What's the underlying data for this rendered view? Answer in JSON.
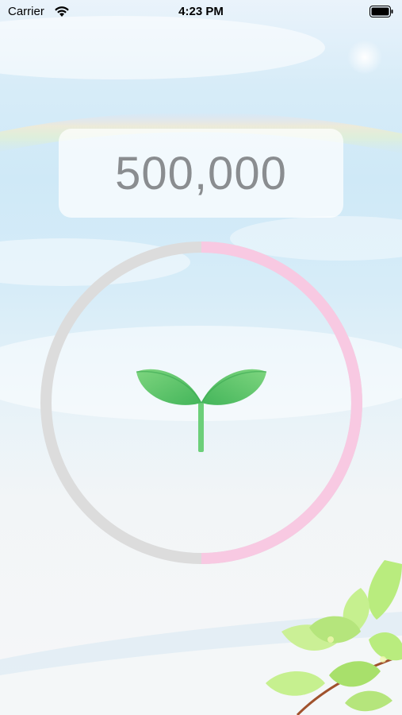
{
  "status_bar": {
    "carrier": "Carrier",
    "time": "4:23 PM",
    "icons": [
      "wifi-icon",
      "battery-icon"
    ]
  },
  "counter": {
    "value": "500,000"
  },
  "progress_ring": {
    "progress": 0.5,
    "track_color": "#dcdcdc",
    "fill_color": "#f8c9e2"
  },
  "sprout": {
    "icon": "sprout-icon",
    "leaf_color": "#5cc96a",
    "stem_color": "#6ccf79"
  },
  "decor": {
    "icon": "leaves-icon"
  }
}
